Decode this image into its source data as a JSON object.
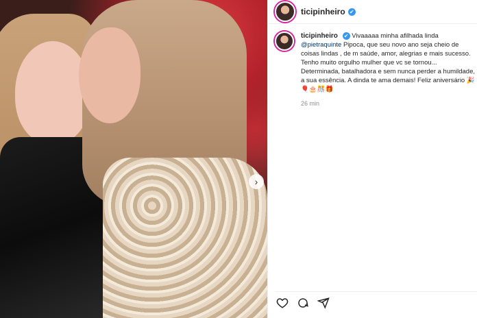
{
  "post": {
    "username": "ticipinheiro",
    "verified_mark": "✔",
    "nav_arrow": "›"
  },
  "caption": {
    "username": "ticipinheiro",
    "text_start": "Vivaaaaa minha afilhada linda ",
    "mention": "@pietraquinte",
    "text_rest": "Pipoca, que seu novo ano seja cheio de coisas lindas , de m saúde, amor, alegrias e mais sucesso. Tenho muito orgulho mulher que vc se tornou... Determinada, batalhadora e sem nunca perder a humildade, a sua essência. A dinda te ama demais! Feliz aniversário 🎉🎈🎂🎊🎁",
    "time": "26 min"
  },
  "icons": [
    "heart-icon",
    "comment-icon",
    "share-icon",
    "verified-icon",
    "chevron-right-icon"
  ],
  "colors": {
    "link": "#00376b",
    "verified": "#3897f0",
    "story_ring": "#d6249f"
  }
}
